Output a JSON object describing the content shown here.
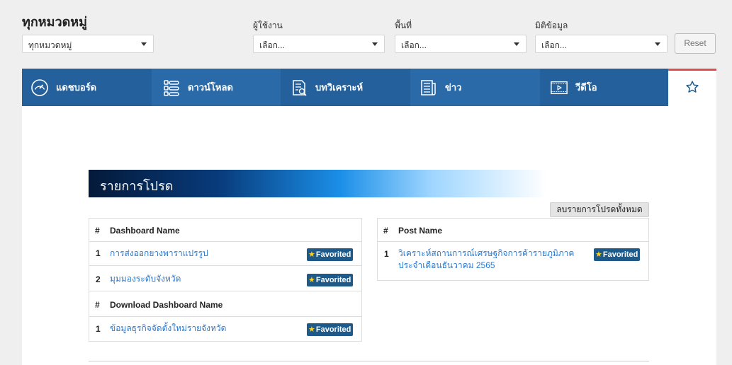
{
  "filters": {
    "category_title": "ทุกหมวดหมู่",
    "category_select": "ทุกหมวดหมู่",
    "user_label": "ผู้ใช้งาน",
    "user_select": "เลือก...",
    "area_label": "พื้นที่",
    "area_select": "เลือก...",
    "dimension_label": "มิติข้อมูล",
    "dimension_select": "เลือก...",
    "reset_label": "Reset"
  },
  "nav": {
    "tabs": [
      {
        "label": "แดชบอร์ด",
        "icon": "speedometer-icon"
      },
      {
        "label": "ดาวน์โหลด",
        "icon": "list-download-icon"
      },
      {
        "label": "บทวิเคราะห์",
        "icon": "document-search-icon"
      },
      {
        "label": "ข่าว",
        "icon": "newspaper-icon"
      },
      {
        "label": "วีดีโอ",
        "icon": "video-icon"
      }
    ],
    "favorite_icon": "star-outline-icon"
  },
  "favorites": {
    "title": "รายการโปรด",
    "clear_all_label": "ลบรายการโปรดทั้งหมด",
    "badge_label": "Favorited",
    "dashboard_table": {
      "hash": "#",
      "header": "Dashboard Name",
      "rows": [
        {
          "num": "1",
          "name": "การส่งออกยางพาราแปรรูป"
        },
        {
          "num": "2",
          "name": "มุมมองระดับจังหวัด"
        }
      ]
    },
    "download_table": {
      "hash": "#",
      "header": "Download Dashboard Name",
      "rows": [
        {
          "num": "1",
          "name": "ข้อมูลธุรกิจจัดตั้งใหม่รายจังหวัด"
        }
      ]
    },
    "post_table": {
      "hash": "#",
      "header": "Post Name",
      "rows": [
        {
          "num": "1",
          "name_line1": "วิเคราะห์สถานการณ์เศรษฐกิจการค้ารายภูมิภาค",
          "name_line2": "ประจำเดือนธันวาคม 2565"
        }
      ]
    }
  },
  "colors": {
    "nav_bg": "#24609c",
    "link": "#2a7ad0",
    "badge_bg": "#1d5a8a",
    "star": "#ffcf1a",
    "accent_red": "#e34c4c"
  }
}
